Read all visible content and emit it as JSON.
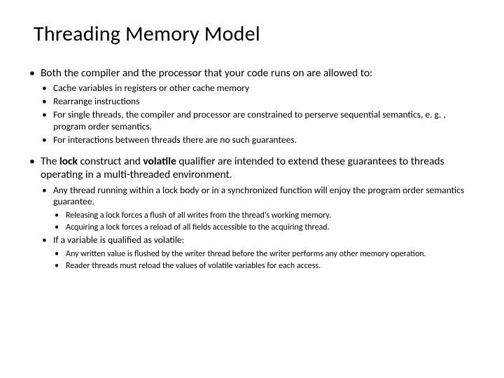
{
  "title": "Threading Memory Model",
  "points": [
    {
      "text": "Both the compiler and the processor that your code runs on are allowed to:",
      "sub": [
        {
          "text": "Cache variables in registers or other cache memory"
        },
        {
          "text": "Rearrange instructions"
        },
        {
          "text": "For single threads, the compiler and processor are constrained to perserve sequential semantics, e. g. , program order semantics."
        },
        {
          "text": "For interactions between threads there are no such guarantees."
        }
      ]
    },
    {
      "text_html": "The <b>lock</b> construct and <b>volatile</b> qualifier are intended to extend these guarantees to threads operating in a multi-threaded environment.",
      "sub": [
        {
          "text": "Any thread running within a lock body or in a synchronized function will enjoy the program order semantics guarantee.",
          "sub": [
            {
              "text": "Releasing a lock forces a flush of all writes from the thread's working memory."
            },
            {
              "text": "Acquiring a lock forces a reload of all fields accessible to the acquiring thread."
            }
          ]
        },
        {
          "text": "If a variable is qualified as volatile:",
          "sub": [
            {
              "text": "Any written value is flushed by the writer thread before the writer performs any other memory operation."
            },
            {
              "text": "Reader threads must reload the values of volatile variables for each access."
            }
          ]
        }
      ]
    }
  ]
}
